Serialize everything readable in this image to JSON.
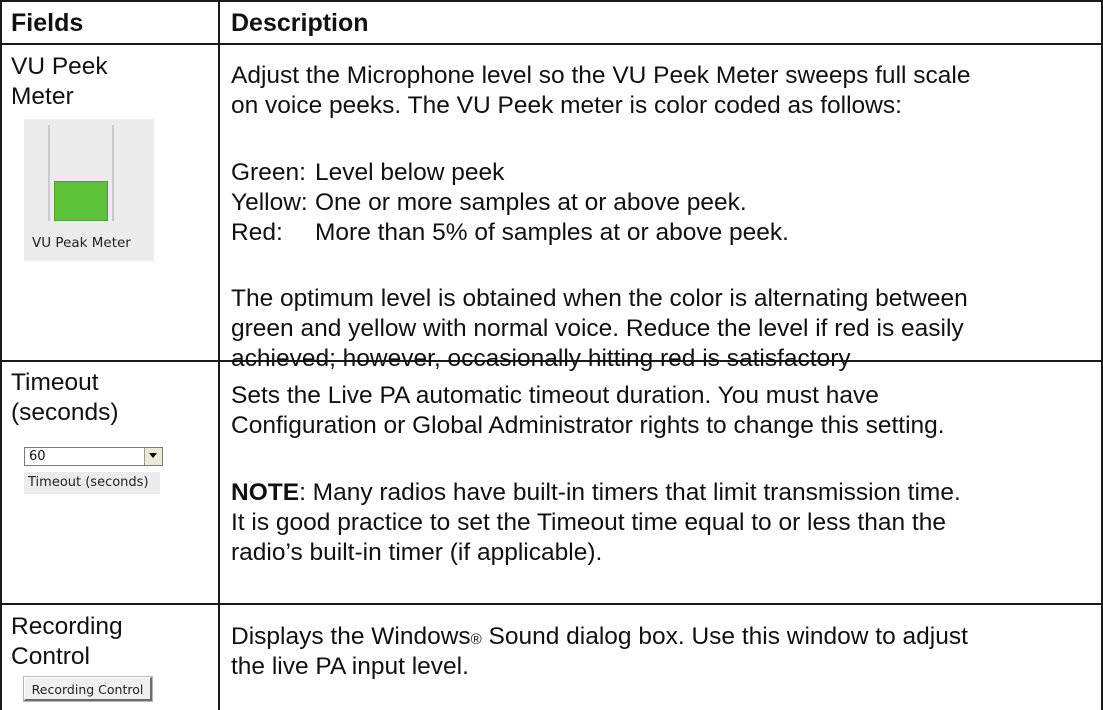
{
  "header": {
    "fields": "Fields",
    "description": "Description"
  },
  "rows": [
    {
      "field_lines": [
        "VU Peek",
        "Meter"
      ],
      "widget": {
        "label": "VU Peak Meter",
        "level": 0.42,
        "color": "#5ec13a"
      },
      "desc_lines": [
        "Adjust the Microphone level so the VU Peek Meter sweeps full scale",
        "on voice peeks. The VU Peek meter is color coded as follows:"
      ],
      "legend": [
        {
          "name": "Green:",
          "text": "Level below peek"
        },
        {
          "name": "Yellow:",
          "text": "One or more samples at or above peek."
        },
        {
          "name": "Red:",
          "text": "More than 5% of samples at or above peek."
        }
      ],
      "desc2_lines": [
        "The optimum level is obtained when the color is alternating between",
        "green and yellow with normal voice. Reduce the level if red is easily",
        "achieved; however, occasionally hitting red is satisfactory"
      ]
    },
    {
      "field_lines": [
        "Timeout",
        "(seconds)"
      ],
      "widget": {
        "value": "60",
        "label": "Timeout (seconds)",
        "icon": "chevron-down-icon"
      },
      "desc_lines": [
        "Sets the Live PA automatic timeout duration. You must have",
        "Configuration or Global Administrator rights to change this setting."
      ],
      "note": {
        "label": "NOTE",
        "line1": ": Many radios have built-in timers that limit transmission time.",
        "line2": "It is good practice to set the Timeout time equal to or less than the",
        "line3": "radio’s built-in timer (if applicable)."
      }
    },
    {
      "field_lines": [
        "Recording",
        "Control"
      ],
      "widget": {
        "button_label": "Recording Control"
      },
      "desc": {
        "part1": "Displays the Windows",
        "reg": "®",
        "part2": " Sound dialog box. Use this window to adjust",
        "line2": "the live PA input level."
      }
    }
  ]
}
